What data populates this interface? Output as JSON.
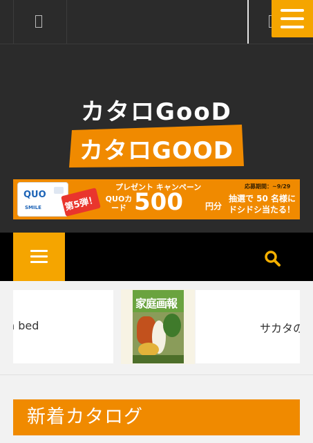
{
  "header": {
    "site_title": "カタロGooD",
    "logo_text": "カタロGOOD"
  },
  "banner": {
    "card_brand": "QUO",
    "card_sub": "SMILE",
    "round_badge": "第5弾！",
    "title": "プレゼント キャンペーン",
    "period": "応募期間：~9/29",
    "card_label": "QUOカード",
    "amount": "500",
    "yen_unit": "円分",
    "lottery_line1": "抽選で 50 名様に",
    "lottery_line2": "ドシドシ当たる！"
  },
  "carousel": {
    "left_item_text": "n bed",
    "center_cover_title": "家庭画報",
    "right_item_text": "サカタの"
  },
  "section": {
    "new_catalog_heading": "新着カタログ"
  },
  "colors": {
    "accent_orange": "#f08a00",
    "menu_yellow": "#f5a500",
    "header_bg": "#2b2b2b"
  },
  "icons": {
    "top_menu": "hamburger-icon",
    "nav_menu": "hamburger-icon",
    "search": "search-icon"
  }
}
